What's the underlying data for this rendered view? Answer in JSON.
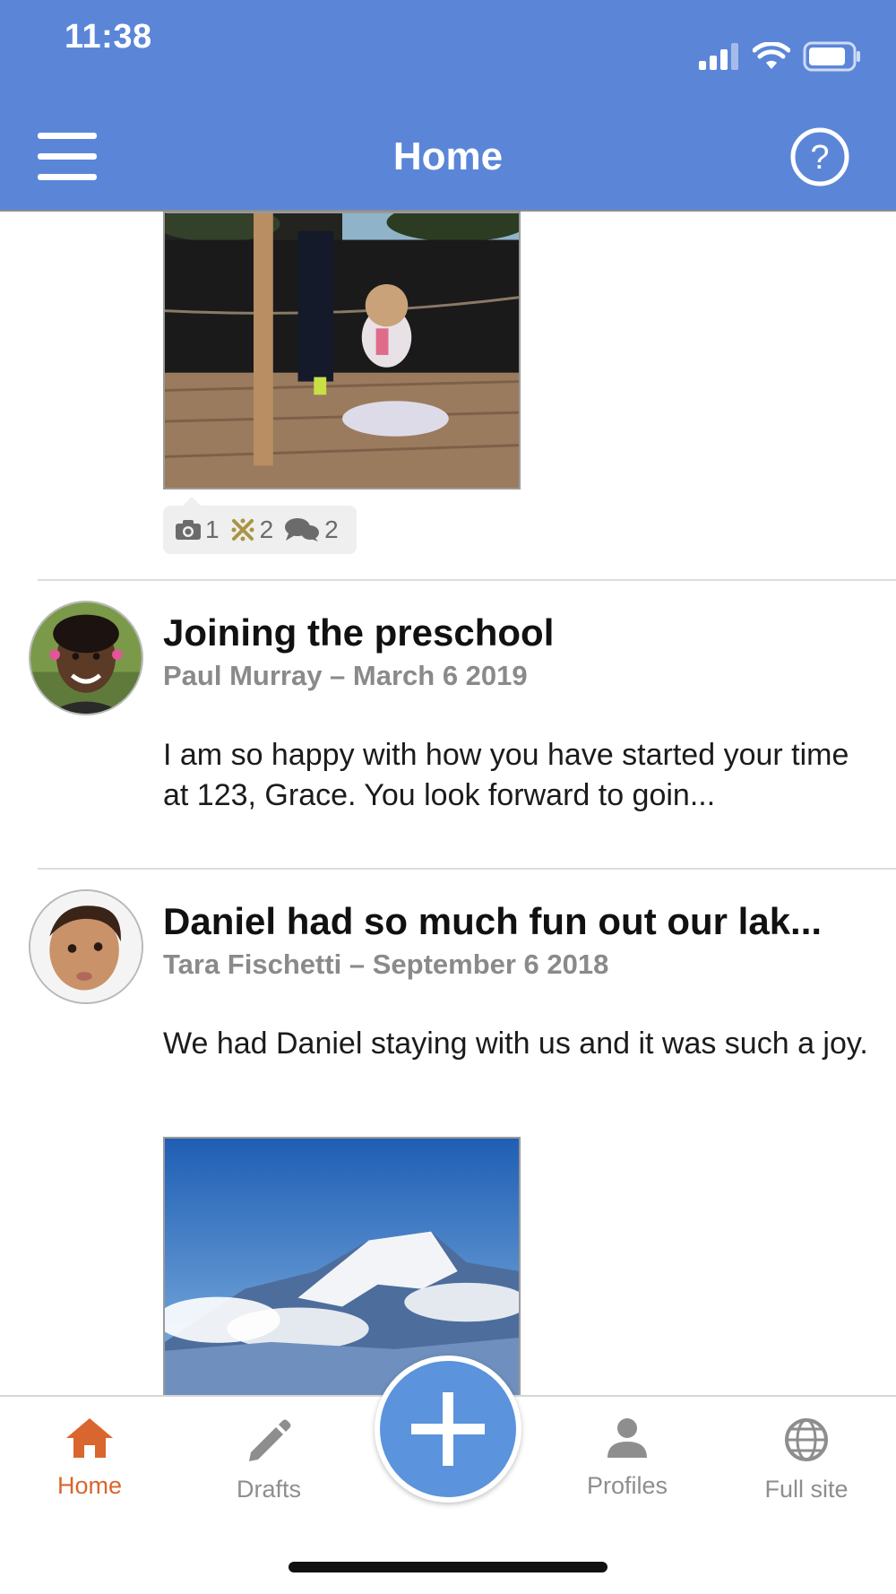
{
  "status_bar": {
    "time": "11:38"
  },
  "header": {
    "title": "Home",
    "menu_icon": "hamburger-menu-icon",
    "help_icon": "question-circle-icon"
  },
  "feed": {
    "stats": {
      "photos": "1",
      "reactions": "2",
      "comments": "2"
    },
    "posts": [
      {
        "title": "Joining the preschool",
        "meta": "Paul Murray – March 6 2019",
        "body": "I am so happy with how you have started your time at 123, Grace. You look forward to goin..."
      },
      {
        "title": "Daniel had so much fun out our lak...",
        "meta": "Tara Fischetti – September 6 2018",
        "body": "We had Daniel staying with us and it was such a joy."
      }
    ]
  },
  "tabbar": {
    "tabs": [
      {
        "label": "Home",
        "icon": "home-icon",
        "active": true
      },
      {
        "label": "Drafts",
        "icon": "pencil-icon"
      },
      {
        "label": "Profiles",
        "icon": "person-icon"
      },
      {
        "label": "Full site",
        "icon": "globe-icon"
      }
    ],
    "add_icon": "plus-icon"
  },
  "colors": {
    "header": "#5b86d8",
    "accent": "#d9662e",
    "fab": "#5b93dc",
    "meta_text": "#8a8a8a"
  }
}
